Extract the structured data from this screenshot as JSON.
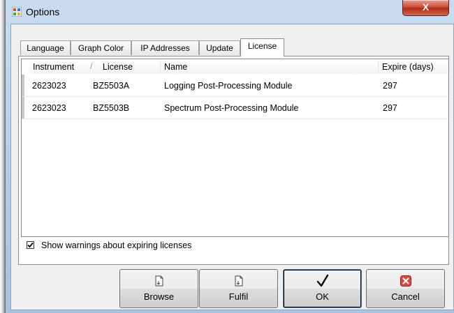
{
  "window": {
    "title": "Options",
    "close_label": "X"
  },
  "tabs": [
    {
      "label": "Language"
    },
    {
      "label": "Graph Color"
    },
    {
      "label": "IP Addresses"
    },
    {
      "label": "Update"
    },
    {
      "label": "License",
      "active": true
    }
  ],
  "table": {
    "columns": [
      "Instrument",
      "License",
      "Name",
      "Expire (days)"
    ],
    "sort_indicator": "/",
    "rows": [
      {
        "instrument": "2623023",
        "license": "BZ5503A",
        "name": "Logging Post-Processing Module",
        "expire": "297"
      },
      {
        "instrument": "2623023",
        "license": "BZ5503B",
        "name": "Spectrum Post-Processing Module",
        "expire": "297"
      }
    ]
  },
  "warnings": {
    "label": "Show warnings about expiring licenses",
    "checked": true
  },
  "buttons": {
    "browse": {
      "label": "Browse",
      "icon": "document-icon"
    },
    "fulfil": {
      "label": "Fulfil",
      "icon": "document-icon"
    },
    "ok": {
      "label": "OK",
      "icon": "checkmark-icon"
    },
    "cancel": {
      "label": "Cancel",
      "icon": "cancel-x-icon",
      "color": "#e0443a"
    }
  }
}
